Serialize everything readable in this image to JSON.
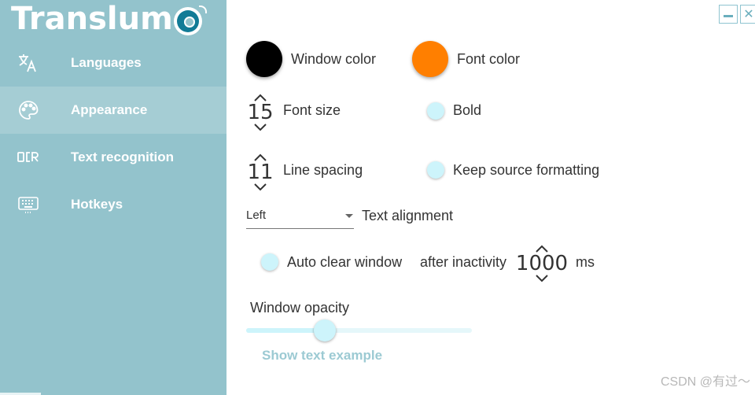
{
  "app": {
    "title": "Translum"
  },
  "sidebar": {
    "items": [
      {
        "label": "Languages",
        "icon": "translate-icon"
      },
      {
        "label": "Appearance",
        "icon": "palette-icon",
        "active": true
      },
      {
        "label": "Text recognition",
        "icon": "ocr-icon"
      },
      {
        "label": "Hotkeys",
        "icon": "keyboard-icon"
      }
    ]
  },
  "window_controls": {
    "minimize": "minimize-icon",
    "close": "✕"
  },
  "appearance": {
    "window_color": {
      "label": "Window color",
      "value": "#000000"
    },
    "font_color": {
      "label": "Font color",
      "value": "#ff7f00"
    },
    "font_size": {
      "label": "Font size",
      "value": "15"
    },
    "bold": {
      "label": "Bold",
      "checked": false
    },
    "line_spacing": {
      "label": "Line spacing",
      "value": "11"
    },
    "keep_source_formatting": {
      "label": "Keep source formatting",
      "checked": false
    },
    "text_alignment": {
      "label": "Text alignment",
      "value": "Left"
    },
    "auto_clear": {
      "label": "Auto clear window",
      "checked": false,
      "after_label": "after inactivity",
      "value": "1000",
      "unit": "ms"
    },
    "opacity": {
      "label": "Window opacity",
      "fraction": 0.35
    },
    "show_example": "Show text example"
  },
  "watermark": "CSDN @有过～",
  "colors": {
    "sidebar": "#93c3cc",
    "sidebar_active": "#a5cdd4",
    "accent": "#cdf4fb",
    "link": "#9ccad3"
  }
}
